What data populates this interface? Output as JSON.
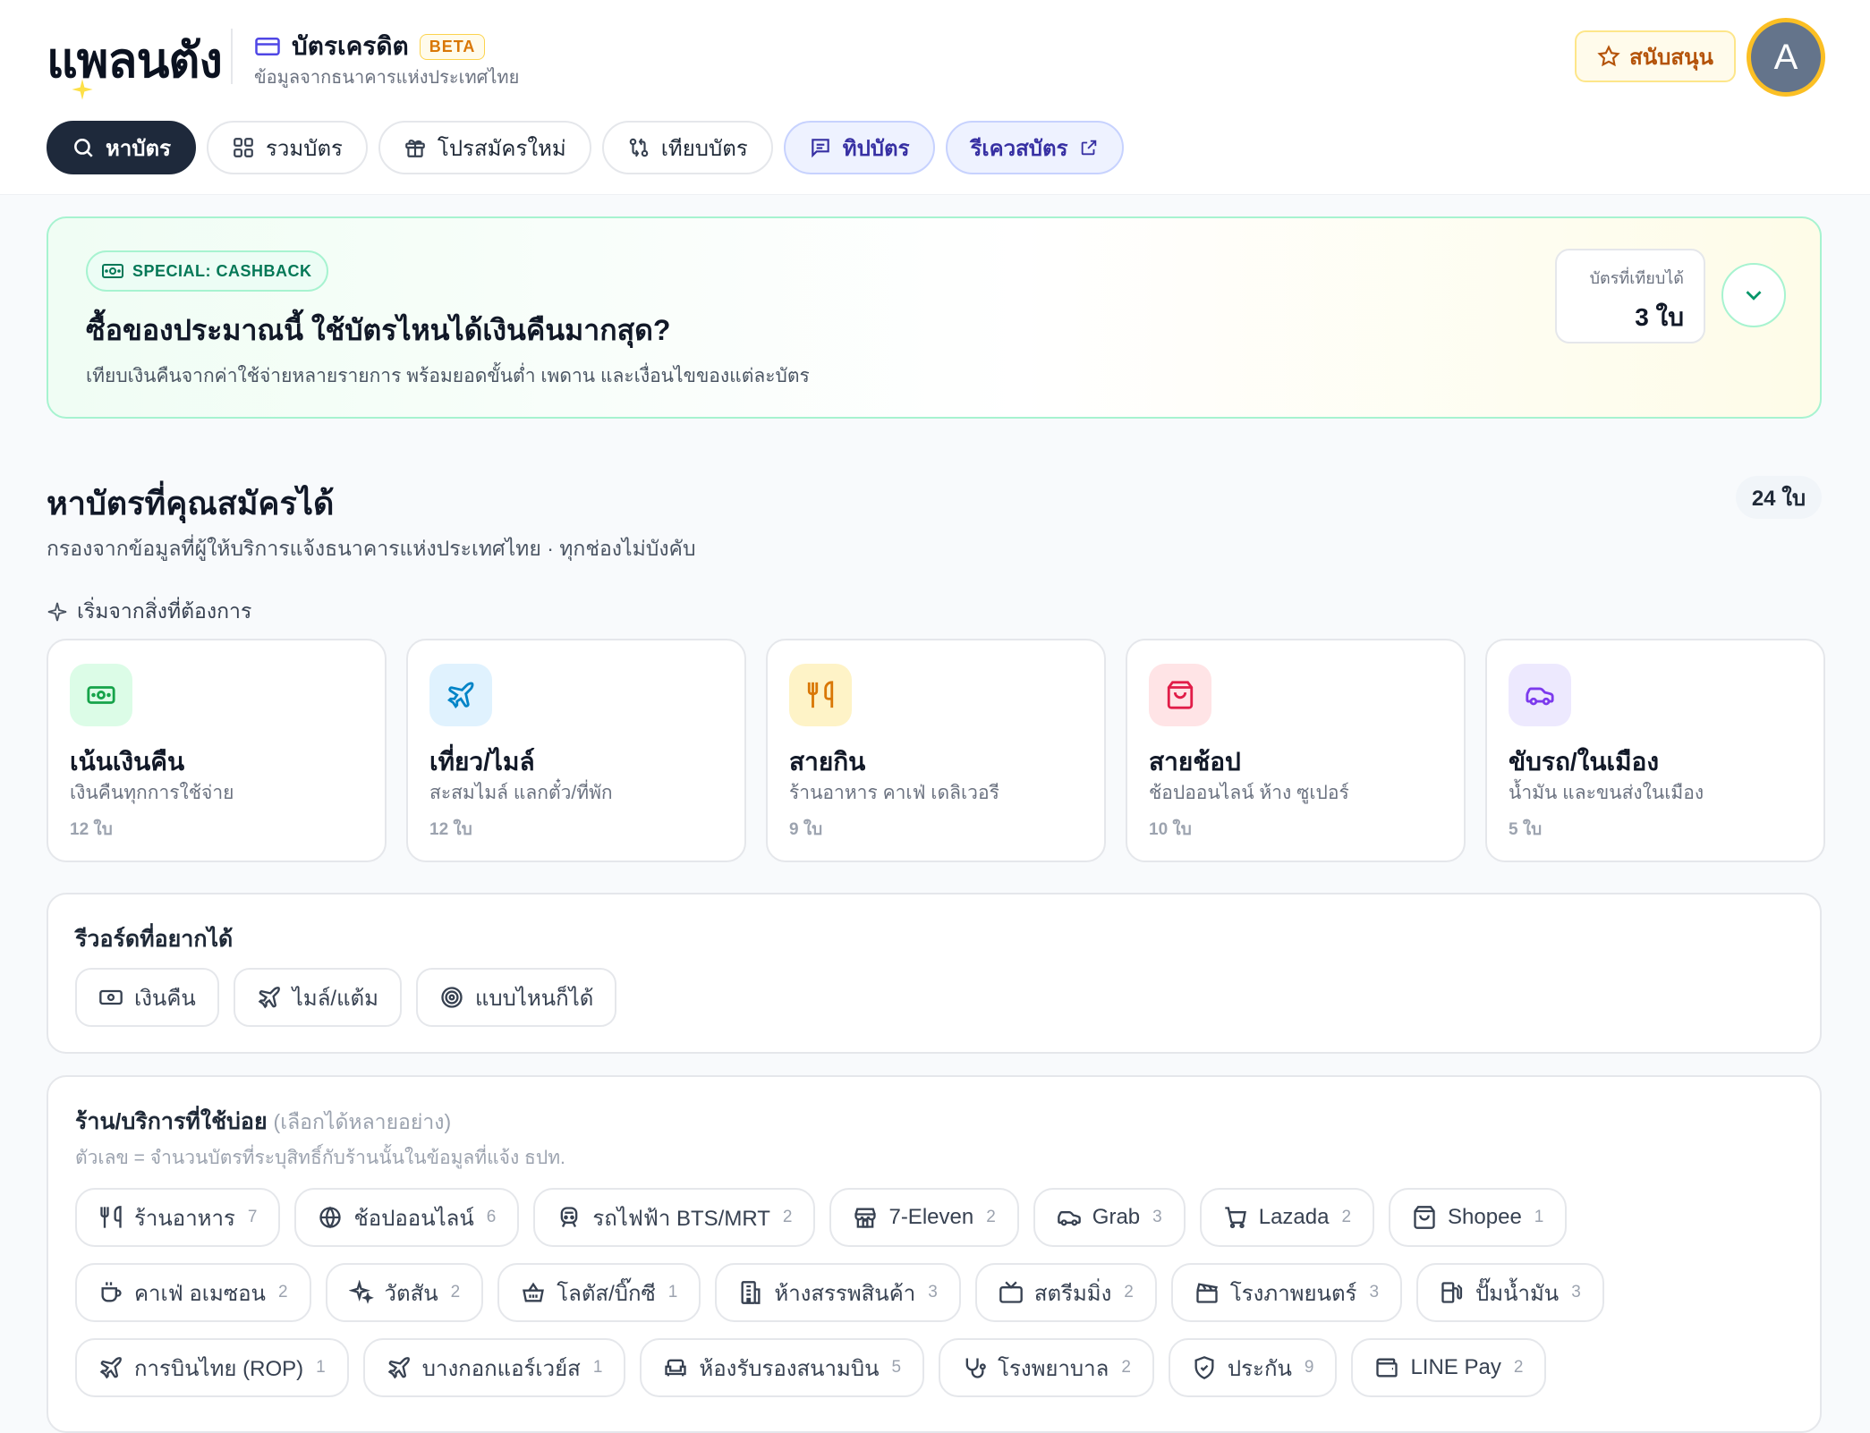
{
  "header": {
    "logo": "แพลนตัง",
    "brand_title": "บัตรเครดิต",
    "beta": "BETA",
    "brand_sub": "ข้อมูลจากธนาคารแห่งประเทศไทย",
    "support_label": "สนับสนุน",
    "avatar_initial": "A"
  },
  "tabs": [
    {
      "label": "หาบัตร",
      "icon": "search-icon"
    },
    {
      "label": "รวมบัตร",
      "icon": "grid-icon"
    },
    {
      "label": "โปรสมัครใหม่",
      "icon": "gift-icon"
    },
    {
      "label": "เทียบบัตร",
      "icon": "compare-icon"
    },
    {
      "label": "ทิปบัตร",
      "icon": "message-icon"
    },
    {
      "label": "รีเควสบัตร",
      "icon": "external-link-icon"
    }
  ],
  "banner": {
    "pill": "SPECIAL: CASHBACK",
    "title": "ซื้อของประมาณนี้ ใช้บัตรไหนได้เงินคืนมากสุด?",
    "desc": "เทียบเงินคืนจากค่าใช้จ่ายหลายรายการ พร้อมยอดขั้นต่ำ เพดาน และเงื่อนไขของแต่ละบัตร",
    "compare_label": "บัตรที่เทียบได้",
    "compare_value": "3 ใบ"
  },
  "section": {
    "title": "หาบัตรที่คุณสมัครได้",
    "sub": "กรองจากข้อมูลที่ผู้ให้บริการแจ้งธนาคารแห่งประเทศไทย · ทุกช่องไม่บังคับ",
    "count": "24 ใบ",
    "start_label": "เริ่มจากสิ่งที่ต้องการ"
  },
  "categories": [
    {
      "title": "เน้นเงินคืน",
      "desc": "เงินคืนทุกการใช้จ่าย",
      "count": "12 ใบ",
      "icon": "cash-icon",
      "bg": "#dcfce7",
      "fg": "#16a34a"
    },
    {
      "title": "เที่ยว/ไมล์",
      "desc": "สะสมไมล์ แลกตั๋ว/ที่พัก",
      "count": "12 ใบ",
      "icon": "plane-icon",
      "bg": "#e0f2fe",
      "fg": "#0284c7"
    },
    {
      "title": "สายกิน",
      "desc": "ร้านอาหาร คาเฟ่ เดลิเวอรี",
      "count": "9 ใบ",
      "icon": "utensils-icon",
      "bg": "#fef3c7",
      "fg": "#d97706"
    },
    {
      "title": "สายช้อป",
      "desc": "ช้อปออนไลน์ ห้าง ซูเปอร์",
      "count": "10 ใบ",
      "icon": "bag-icon",
      "bg": "#ffe4e6",
      "fg": "#e11d48"
    },
    {
      "title": "ขับรถ/ในเมือง",
      "desc": "น้ำมัน และขนส่งในเมือง",
      "count": "5 ใบ",
      "icon": "car-icon",
      "bg": "#ede9fe",
      "fg": "#7c3aed"
    }
  ],
  "rewards": {
    "title": "รีวอร์ดที่อยากได้",
    "options": [
      {
        "label": "เงินคืน",
        "icon": "cash-icon"
      },
      {
        "label": "ไมล์/แต้ม",
        "icon": "plane-icon"
      },
      {
        "label": "แบบไหนก็ได้",
        "icon": "target-icon"
      }
    ]
  },
  "merchants": {
    "title": "ร้าน/บริการที่ใช้บ่อย",
    "title_hint": "(เลือกได้หลายอย่าง)",
    "note": "ตัวเลข = จำนวนบัตรที่ระบุสิทธิ์กับร้านนั้นในข้อมูลที่แจ้ง ธปท.",
    "items": [
      {
        "label": "ร้านอาหาร",
        "n": "7",
        "icon": "utensils-icon"
      },
      {
        "label": "ช้อปออนไลน์",
        "n": "6",
        "icon": "globe-icon"
      },
      {
        "label": "รถไฟฟ้า BTS/MRT",
        "n": "2",
        "icon": "train-icon"
      },
      {
        "label": "7-Eleven",
        "n": "2",
        "icon": "store-icon"
      },
      {
        "label": "Grab",
        "n": "3",
        "icon": "car-icon"
      },
      {
        "label": "Lazada",
        "n": "2",
        "icon": "cart-icon"
      },
      {
        "label": "Shopee",
        "n": "1",
        "icon": "bag-icon"
      },
      {
        "label": "คาเฟ่ อเมซอน",
        "n": "2",
        "icon": "coffee-icon"
      },
      {
        "label": "วัตสัน",
        "n": "2",
        "icon": "sparkle-icon"
      },
      {
        "label": "โลตัส/บิ๊กซี",
        "n": "1",
        "icon": "basket-icon"
      },
      {
        "label": "ห้างสรรพสินค้า",
        "n": "3",
        "icon": "building-icon"
      },
      {
        "label": "สตรีมมิ่ง",
        "n": "2",
        "icon": "tv-icon"
      },
      {
        "label": "โรงภาพยนตร์",
        "n": "3",
        "icon": "clapper-icon"
      },
      {
        "label": "ปั๊มน้ำมัน",
        "n": "3",
        "icon": "fuel-icon"
      },
      {
        "label": "การบินไทย (ROP)",
        "n": "1",
        "icon": "plane-icon"
      },
      {
        "label": "บางกอกแอร์เวย์ส",
        "n": "1",
        "icon": "plane-icon"
      },
      {
        "label": "ห้องรับรองสนามบิน",
        "n": "5",
        "icon": "sofa-icon"
      },
      {
        "label": "โรงพยาบาล",
        "n": "2",
        "icon": "stethoscope-icon"
      },
      {
        "label": "ประกัน",
        "n": "9",
        "icon": "shield-icon"
      },
      {
        "label": "LINE Pay",
        "n": "2",
        "icon": "wallet-icon"
      }
    ]
  }
}
